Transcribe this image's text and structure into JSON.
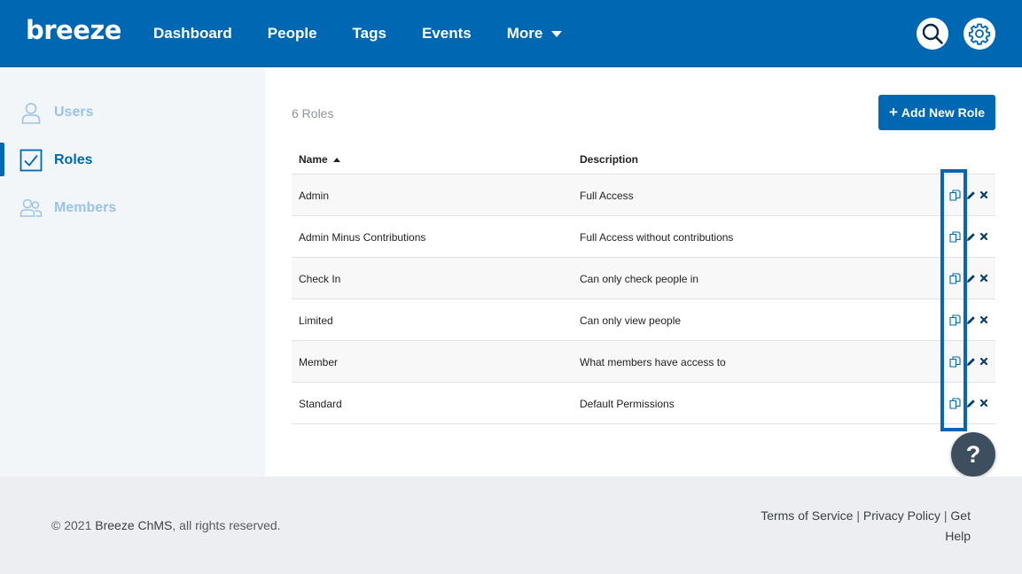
{
  "header": {
    "logo": "breeze",
    "nav": [
      {
        "label": "Dashboard"
      },
      {
        "label": "People"
      },
      {
        "label": "Tags"
      },
      {
        "label": "Events"
      },
      {
        "label": "More"
      }
    ],
    "search_icon": "search-icon",
    "settings_icon": "gear-icon"
  },
  "sidebar": {
    "items": [
      {
        "label": "Users",
        "icon": "user-icon",
        "active": false
      },
      {
        "label": "Roles",
        "icon": "checkbox-icon",
        "active": true
      },
      {
        "label": "Members",
        "icon": "members-icon",
        "active": false
      }
    ]
  },
  "main": {
    "role_count": "6 Roles",
    "add_button": "Add New Role",
    "add_button_icon": "+",
    "columns": {
      "name": "Name",
      "description": "Description"
    },
    "rows": [
      {
        "name": "Admin",
        "description": "Full Access"
      },
      {
        "name": "Admin Minus Contributions",
        "description": "Full Access without contributions"
      },
      {
        "name": "Check In",
        "description": "Can only check people in"
      },
      {
        "name": "Limited",
        "description": "Can only view people"
      },
      {
        "name": "Member",
        "description": "What members have access to"
      },
      {
        "name": "Standard",
        "description": "Default Permissions"
      }
    ],
    "row_actions": [
      "copy-icon",
      "pencil-icon",
      "close-icon"
    ]
  },
  "help_button": "?",
  "footer": {
    "copyright_prefix": "© 2021",
    "brand": "Breeze ChMS",
    "copyright_suffix": ", all rights reserved.",
    "links": [
      {
        "label": "Terms of Service"
      },
      {
        "label": "Privacy Policy"
      },
      {
        "label": "Get Help"
      }
    ],
    "separator": "|"
  },
  "colors": {
    "brand_blue": "#0067b3",
    "sidebar_bg": "#f3f6f9",
    "footer_bg": "#eceef1",
    "help_bg": "#3d4f5e"
  }
}
